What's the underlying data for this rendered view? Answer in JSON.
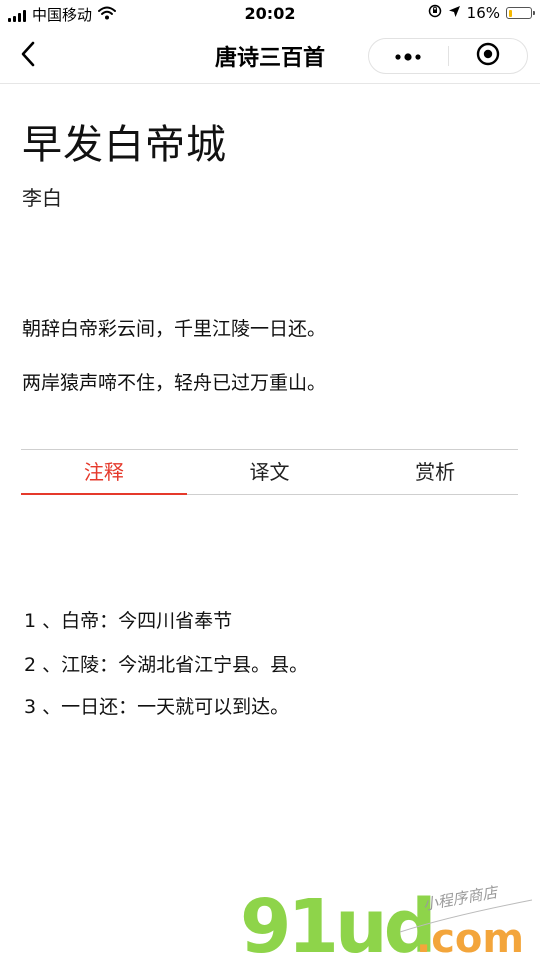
{
  "status_bar": {
    "carrier": "中国移动",
    "time": "20:02",
    "battery_percent": "16%",
    "battery_level": 0.16,
    "icons": [
      "signal-icon",
      "wifi-icon",
      "orientation-lock-icon",
      "location-icon",
      "battery-icon"
    ]
  },
  "nav": {
    "title": "唐诗三百首",
    "back_icon": "chevron-left-icon",
    "menu_icon": "more-dots-icon",
    "close_icon": "target-circle-icon"
  },
  "poem": {
    "title": "早发白帝城",
    "author": "李白",
    "lines": [
      "朝辞白帝彩云间，千里江陵一日还。",
      "两岸猿声啼不住，轻舟已过万重山。"
    ]
  },
  "tabs": [
    {
      "label": "注释",
      "active": true
    },
    {
      "label": "译文",
      "active": false
    },
    {
      "label": "赏析",
      "active": false
    }
  ],
  "notes": [
    "1 、白帝：今四川省奉节",
    "2 、江陵：今湖北省江宁县。县。",
    "3 、一日还：一天就可以到达。"
  ],
  "watermark": {
    "logo_text": "91ud",
    "domain": ".com",
    "tagline": "小程序商店"
  },
  "colors": {
    "accent": "#e5392b",
    "watermark_green": "#8ed44a",
    "watermark_orange": "#f3a53b"
  }
}
